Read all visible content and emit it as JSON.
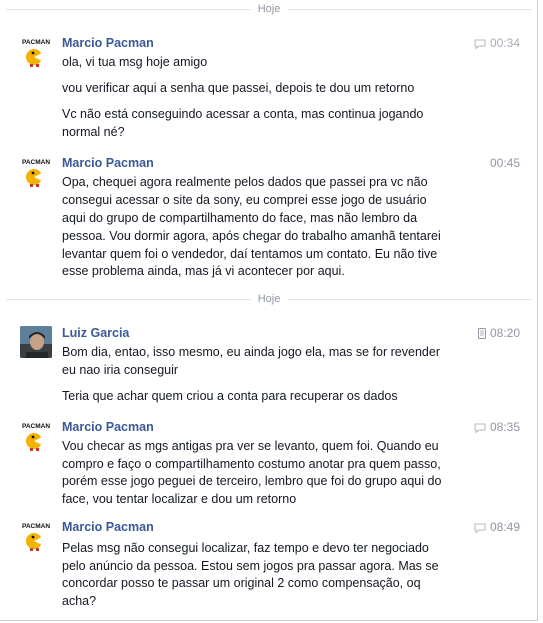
{
  "dividers": [
    "Hoje",
    "Hoje"
  ],
  "messages": [
    {
      "sender": "Marcio Pacman",
      "time": "00:34",
      "via": "chat",
      "avatar_text": "PACMAN",
      "lines": [
        "ola, vi tua msg hoje amigo",
        "vou verificar aqui a senha que passei, depois te dou um retorno",
        "Vc não está conseguindo acessar a conta, mas continua jogando",
        "normal né?"
      ]
    },
    {
      "sender": "Marcio Pacman",
      "time": "00:45",
      "via": "",
      "avatar_text": "PACMAN",
      "lines": [
        "Opa, chequei agora realmente pelos dados que passei pra vc não",
        "consegui acessar o site da sony, eu comprei esse jogo de usuário",
        "aqui do grupo de compartilhamento do face, mas não lembro da",
        "pessoa. Vou dormir agora, após chegar do trabalho amanhã tentarei",
        "levantar quem foi o vendedor, daí tentamos um contato. Eu não tive",
        "esse problema ainda, mas já vi acontecer por aqui."
      ]
    },
    {
      "sender": "Luiz Garcia",
      "time": "08:20",
      "via": "mobile",
      "avatar_text": "",
      "lines": [
        "Bom dia, entao, isso mesmo, eu ainda jogo ela, mas se for revender",
        "eu nao iria conseguir",
        "Teria que achar quem criou a conta para recuperar os dados"
      ]
    },
    {
      "sender": "Marcio Pacman",
      "time": "08:35",
      "via": "chat",
      "avatar_text": "PACMAN",
      "lines": [
        "Vou checar as mgs antigas pra ver se levanto, quem foi. Quando eu",
        "compro e faço o compartilhamento costumo anotar pra quem passo,",
        "porém esse jogo peguei de terceiro, lembro que foi do grupo aqui do",
        "face, vou tentar localizar e dou um retorno"
      ]
    },
    {
      "sender": "Marcio Pacman",
      "time": "08:49",
      "via": "chat",
      "avatar_text": "PACMAN",
      "lines": [
        "Pelas msg não consegui localizar, faz tempo e devo ter negociado",
        "pelo anúncio da pessoa. Estou sem jogos pra passar agora. Mas se",
        "concordar posso te passar um original 2 como compensação, oq",
        "acha?"
      ]
    }
  ]
}
